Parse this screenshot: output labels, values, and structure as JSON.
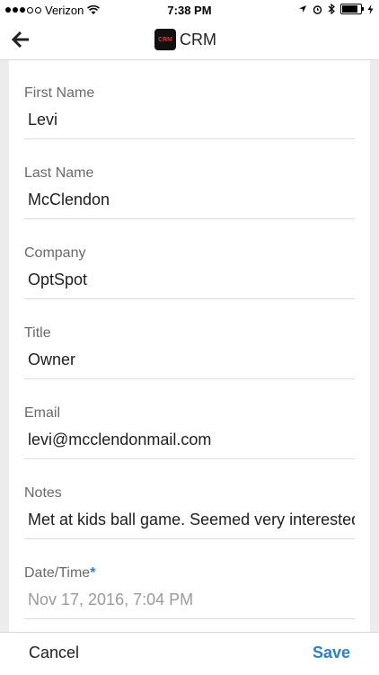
{
  "status_bar": {
    "carrier": "Verizon",
    "time": "7:38 PM",
    "signal_bars_filled": 3,
    "signal_bars_total": 5,
    "battery_level": 0.85
  },
  "nav": {
    "title": "CRM",
    "logo_text": "CRM",
    "back_icon": "arrow-left-icon"
  },
  "fields": [
    {
      "label": "First Name",
      "value": "Levi",
      "required": false
    },
    {
      "label": "Last Name",
      "value": "McClendon",
      "required": false
    },
    {
      "label": "Company",
      "value": "OptSpot",
      "required": false
    },
    {
      "label": "Title",
      "value": "Owner",
      "required": false
    },
    {
      "label": "Email",
      "value": "levi@mcclendonmail.com",
      "required": false
    },
    {
      "label": "Notes",
      "value": "Met at kids ball game. Seemed very interested",
      "required": false
    },
    {
      "label": "Date/Time",
      "value": "Nov 17, 2016, 7:04 PM",
      "required": true,
      "required_mark": "*"
    }
  ],
  "bottom_bar": {
    "cancel_label": "Cancel",
    "save_label": "Save"
  },
  "colors": {
    "accent": "#2c7fc9",
    "logo_text": "#e0302e"
  }
}
